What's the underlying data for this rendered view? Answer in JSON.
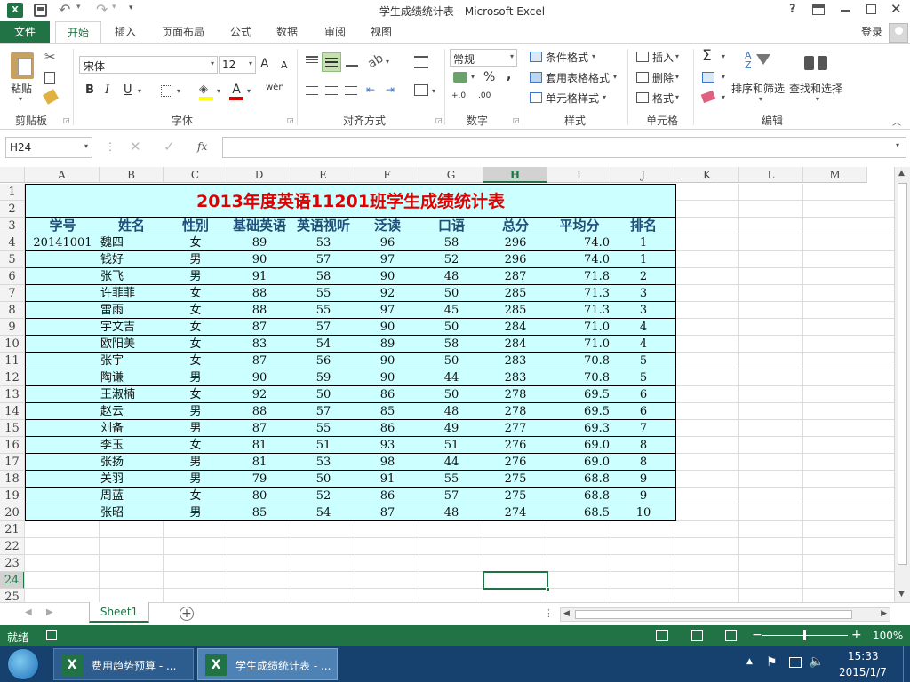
{
  "window": {
    "title": "学生成绩统计表 - Microsoft Excel",
    "controls": [
      "?",
      "⧉",
      "—",
      "🗗",
      "✕"
    ],
    "qat": {
      "save": "save",
      "undo": "undo",
      "redo": "redo",
      "more": "▾"
    }
  },
  "tabs": {
    "file": "文件",
    "items": [
      "开始",
      "插入",
      "页面布局",
      "公式",
      "数据",
      "审阅",
      "视图"
    ],
    "active": "开始",
    "login": "登录"
  },
  "ribbon": {
    "clipboard": {
      "label": "剪贴板",
      "paste": "粘贴"
    },
    "font": {
      "label": "字体",
      "name": "宋体",
      "size": "12",
      "grow": "A",
      "shrink": "A",
      "bold": "B",
      "italic": "I",
      "underline": "U",
      "wen": "wén",
      "fontcolor": "A"
    },
    "align": {
      "label": "对齐方式"
    },
    "number": {
      "label": "数字",
      "format": "常规",
      "percent": "%",
      "comma": ",",
      "inc": "+.0",
      "dec": ".00"
    },
    "styles": {
      "label": "样式",
      "cond": "条件格式",
      "table": "套用表格格式",
      "cell": "单元格样式"
    },
    "cells": {
      "label": "单元格",
      "insert": "插入",
      "delete": "删除",
      "format": "格式"
    },
    "edit": {
      "label": "编辑",
      "sort": "排序和筛选",
      "find": "查找和选择",
      "sum": "Σ"
    }
  },
  "formula_bar": {
    "name_box": "H24",
    "fx": "fx",
    "content": ""
  },
  "columns": [
    "A",
    "B",
    "C",
    "D",
    "E",
    "F",
    "G",
    "H",
    "I",
    "J",
    "K",
    "L",
    "M"
  ],
  "selected_column": "H",
  "rows": [
    "1",
    "2",
    "3",
    "4",
    "5",
    "6",
    "7",
    "8",
    "9",
    "10",
    "11",
    "12",
    "13",
    "14",
    "15",
    "16",
    "17",
    "18",
    "19",
    "20",
    "21",
    "22",
    "23",
    "24",
    "25"
  ],
  "selected_row": "24",
  "sheet": {
    "title": "2013年度英语11201班学生成绩统计表",
    "headers": [
      "学号",
      "姓名",
      "性别",
      "基础英语",
      "英语视听",
      "泛读",
      "口语",
      "总分",
      "平均分",
      "排名"
    ],
    "data": [
      [
        "20141001",
        "魏四",
        "女",
        "89",
        "53",
        "96",
        "58",
        "296",
        "74.0",
        "1"
      ],
      [
        "",
        "钱好",
        "男",
        "90",
        "57",
        "97",
        "52",
        "296",
        "74.0",
        "1"
      ],
      [
        "",
        "张飞",
        "男",
        "91",
        "58",
        "90",
        "48",
        "287",
        "71.8",
        "2"
      ],
      [
        "",
        "许菲菲",
        "女",
        "88",
        "55",
        "92",
        "50",
        "285",
        "71.3",
        "3"
      ],
      [
        "",
        "雷雨",
        "女",
        "88",
        "55",
        "97",
        "45",
        "285",
        "71.3",
        "3"
      ],
      [
        "",
        "宇文吉",
        "女",
        "87",
        "57",
        "90",
        "50",
        "284",
        "71.0",
        "4"
      ],
      [
        "",
        "欧阳美",
        "女",
        "83",
        "54",
        "89",
        "58",
        "284",
        "71.0",
        "4"
      ],
      [
        "",
        "张宇",
        "女",
        "87",
        "56",
        "90",
        "50",
        "283",
        "70.8",
        "5"
      ],
      [
        "",
        "陶谦",
        "男",
        "90",
        "59",
        "90",
        "44",
        "283",
        "70.8",
        "5"
      ],
      [
        "",
        "王淑楠",
        "女",
        "92",
        "50",
        "86",
        "50",
        "278",
        "69.5",
        "6"
      ],
      [
        "",
        "赵云",
        "男",
        "88",
        "57",
        "85",
        "48",
        "278",
        "69.5",
        "6"
      ],
      [
        "",
        "刘备",
        "男",
        "87",
        "55",
        "86",
        "49",
        "277",
        "69.3",
        "7"
      ],
      [
        "",
        "李玉",
        "女",
        "81",
        "51",
        "93",
        "51",
        "276",
        "69.0",
        "8"
      ],
      [
        "",
        "张扬",
        "男",
        "81",
        "53",
        "98",
        "44",
        "276",
        "69.0",
        "8"
      ],
      [
        "",
        "关羽",
        "男",
        "79",
        "50",
        "91",
        "55",
        "275",
        "68.8",
        "9"
      ],
      [
        "",
        "周蓝",
        "女",
        "80",
        "52",
        "86",
        "57",
        "275",
        "68.8",
        "9"
      ],
      [
        "",
        "张昭",
        "男",
        "85",
        "54",
        "87",
        "48",
        "274",
        "68.5",
        "10"
      ]
    ]
  },
  "sheet_tab": "Sheet1",
  "status": {
    "ready": "就绪",
    "zoom": "100%"
  },
  "taskbar": {
    "items": [
      "费用趋势预算 - ...",
      "学生成绩统计表 - ..."
    ],
    "time": "15:33",
    "date": "2015/1/7"
  },
  "colors": {
    "excel_green": "#217346",
    "cell_fill": "#ccffff",
    "title_red": "#e00000",
    "header_blue": "#1f4e79",
    "taskbar": "#16416e"
  }
}
